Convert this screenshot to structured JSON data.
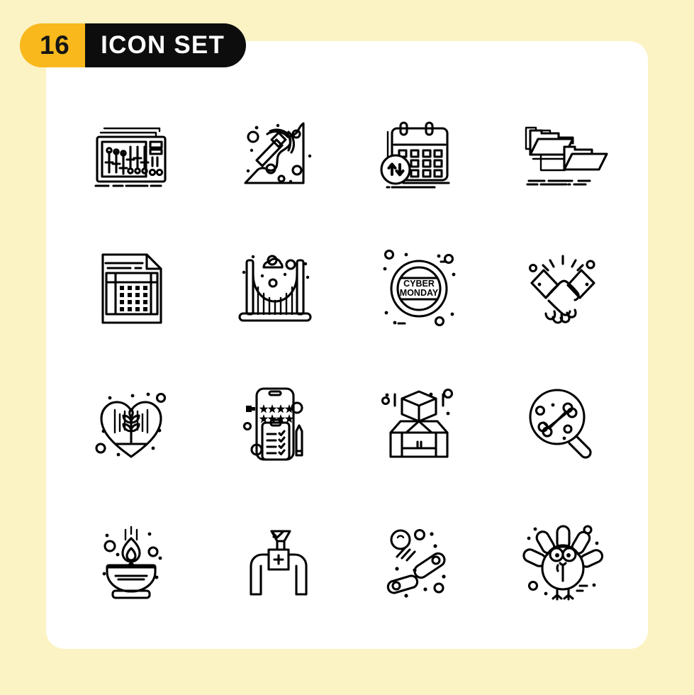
{
  "page": {
    "background_color": "#fcf3c4",
    "card_color": "#ffffff"
  },
  "header": {
    "count": "16",
    "title": "ICON SET",
    "count_bg": "#f9b81c",
    "title_bg": "#0d0d0d",
    "count_text_color": "#151515",
    "title_text_color": "#ffffff"
  },
  "grid": {
    "rows": 4,
    "columns": 4,
    "total": 16,
    "stroke_color": "#000000",
    "style": "outline"
  },
  "icons": [
    {
      "index": 1,
      "name": "mixing-console-icon",
      "label": "Mixing Console"
    },
    {
      "index": 2,
      "name": "pickaxe-mining-icon",
      "label": "Mining Pickaxe"
    },
    {
      "index": 3,
      "name": "calendar-sync-icon",
      "label": "Calendar Transfer"
    },
    {
      "index": 4,
      "name": "folder-structure-icon",
      "label": "Folder Structure"
    },
    {
      "index": 5,
      "name": "spreadsheet-file-icon",
      "label": "Spreadsheet File"
    },
    {
      "index": 6,
      "name": "suspension-bridge-icon",
      "label": "Suspension Bridge"
    },
    {
      "index": 7,
      "name": "cyber-monday-badge-icon",
      "label": "Cyber Monday Badge",
      "text_line1": "CYBER",
      "text_line2": "MONDAY"
    },
    {
      "index": 8,
      "name": "handshake-icon",
      "label": "Handshake"
    },
    {
      "index": 9,
      "name": "eco-heart-plant-icon",
      "label": "Heart Plant"
    },
    {
      "index": 10,
      "name": "mobile-survey-icon",
      "label": "Mobile Survey Rating"
    },
    {
      "index": 11,
      "name": "open-box-package-icon",
      "label": "Open Box Package"
    },
    {
      "index": 12,
      "name": "bone-search-icon",
      "label": "Bone Search"
    },
    {
      "index": 13,
      "name": "diya-oil-lamp-icon",
      "label": "Diya Oil Lamp"
    },
    {
      "index": 14,
      "name": "stethoscope-icon",
      "label": "Stethoscope"
    },
    {
      "index": 15,
      "name": "pinball-icon",
      "label": "Pinball"
    },
    {
      "index": 16,
      "name": "turkey-icon",
      "label": "Turkey"
    }
  ]
}
